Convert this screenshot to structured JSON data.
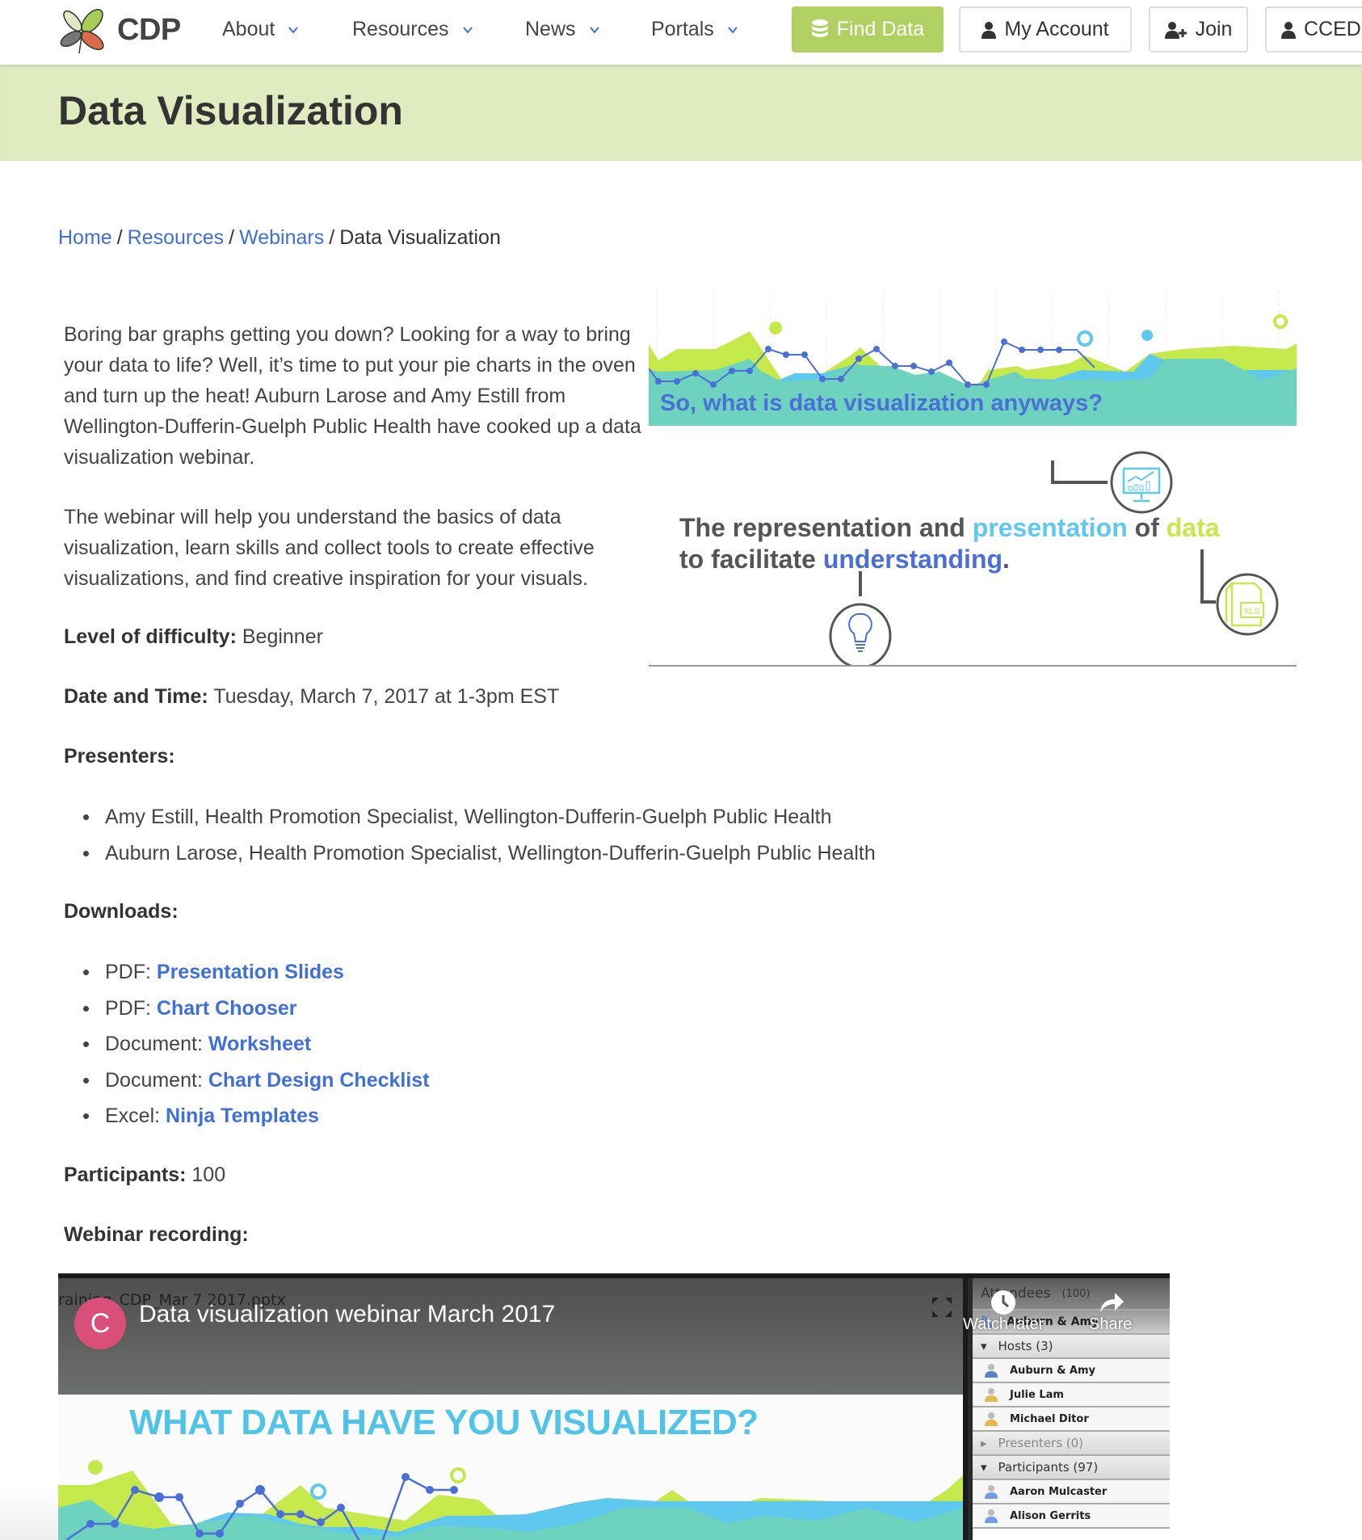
{
  "nav": {
    "brand": "CDP",
    "menu": [
      {
        "label": "About"
      },
      {
        "label": "Resources"
      },
      {
        "label": "News"
      },
      {
        "label": "Portals"
      }
    ],
    "buttons": {
      "find_data": "Find Data",
      "my_account": "My Account",
      "join": "Join",
      "cced": "CCED"
    },
    "accent_color": "#b0d162"
  },
  "banner": {
    "title": "Data Visualization",
    "background_color": "#e0ebbf"
  },
  "breadcrumb": {
    "items": [
      "Home",
      "Resources",
      "Webinars"
    ],
    "separator": "/",
    "current": "Data Visualization"
  },
  "intro": {
    "paragraph_1": "Boring bar graphs getting you down? Looking for a way to bring your data to life? Well, it’s time to put your pie charts in the oven and turn up the heat! Auburn Larose and Amy Estill from Wellington-Dufferin-Guelph Public Health have cooked up a data visualization webinar.",
    "paragraph_2": "The webinar will help you understand the basics of data visualization, learn skills and collect tools to create effective visualizations, and find creative inspiration for your visuals."
  },
  "details": {
    "difficulty_label": "Level of difficulty:",
    "difficulty_value": "Beginner",
    "datetime_label": "Date and Time:",
    "datetime_value": "Tuesday, March 7, 2017 at 1-3pm EST",
    "presenters_label": "Presenters:",
    "presenters": [
      "Amy Estill, Health Promotion Specialist, Wellington-Dufferin-Guelph Public Health",
      "Auburn Larose, Health Promotion Specialist, Wellington-Dufferin-Guelph Public Health"
    ],
    "downloads_label": "Downloads:",
    "downloads": [
      {
        "type": "PDF:",
        "link": "Presentation Slides"
      },
      {
        "type": "PDF:",
        "link": "Chart Chooser"
      },
      {
        "type": "Document:",
        "link": "Worksheet"
      },
      {
        "type": "Document:",
        "link": "Chart Design Checklist"
      },
      {
        "type": "Excel:",
        "link": "Ninja Templates"
      }
    ],
    "participants_label": "Participants:",
    "participants_value": "100",
    "recording_label": "Webinar recording:"
  },
  "infographic": {
    "heading": "So, what is data visualization anyways?",
    "definition_part1": "The representation and ",
    "definition_word_presentation": "presentation",
    "definition_part2": " of ",
    "definition_word_data": "data",
    "definition_part3": "to facilitate ",
    "definition_word_understanding": "understanding",
    "definition_end": ".",
    "icon_xls_label": "XLS",
    "colors": {
      "lime": "#c5e84a",
      "teal": "#6dd3bf",
      "sky": "#5ec8ee",
      "blue": "#4a6fd8",
      "dark": "#555555"
    }
  },
  "video": {
    "channel_initial": "C",
    "title": "Data visualization webinar March 2017",
    "slide_filename": "raining_CDP_Mar 7 2017.pptx",
    "slide_heading": "WHAT DATA HAVE YOU VISUALIZED?",
    "watch_later": "Watch later",
    "share": "Share",
    "attendees_label": "Attendees",
    "attendees_count": "(100)",
    "speaking": "Auburn & Amy",
    "hosts_label": "Hosts (3)",
    "hosts": [
      "Auburn & Amy",
      "Julie Lam",
      "Michael Ditor"
    ],
    "presenters_label": "Presenters (0)",
    "participants_label": "Participants (97)",
    "participants": [
      "Aaron Mulcaster",
      "Alison Gerrits"
    ]
  }
}
